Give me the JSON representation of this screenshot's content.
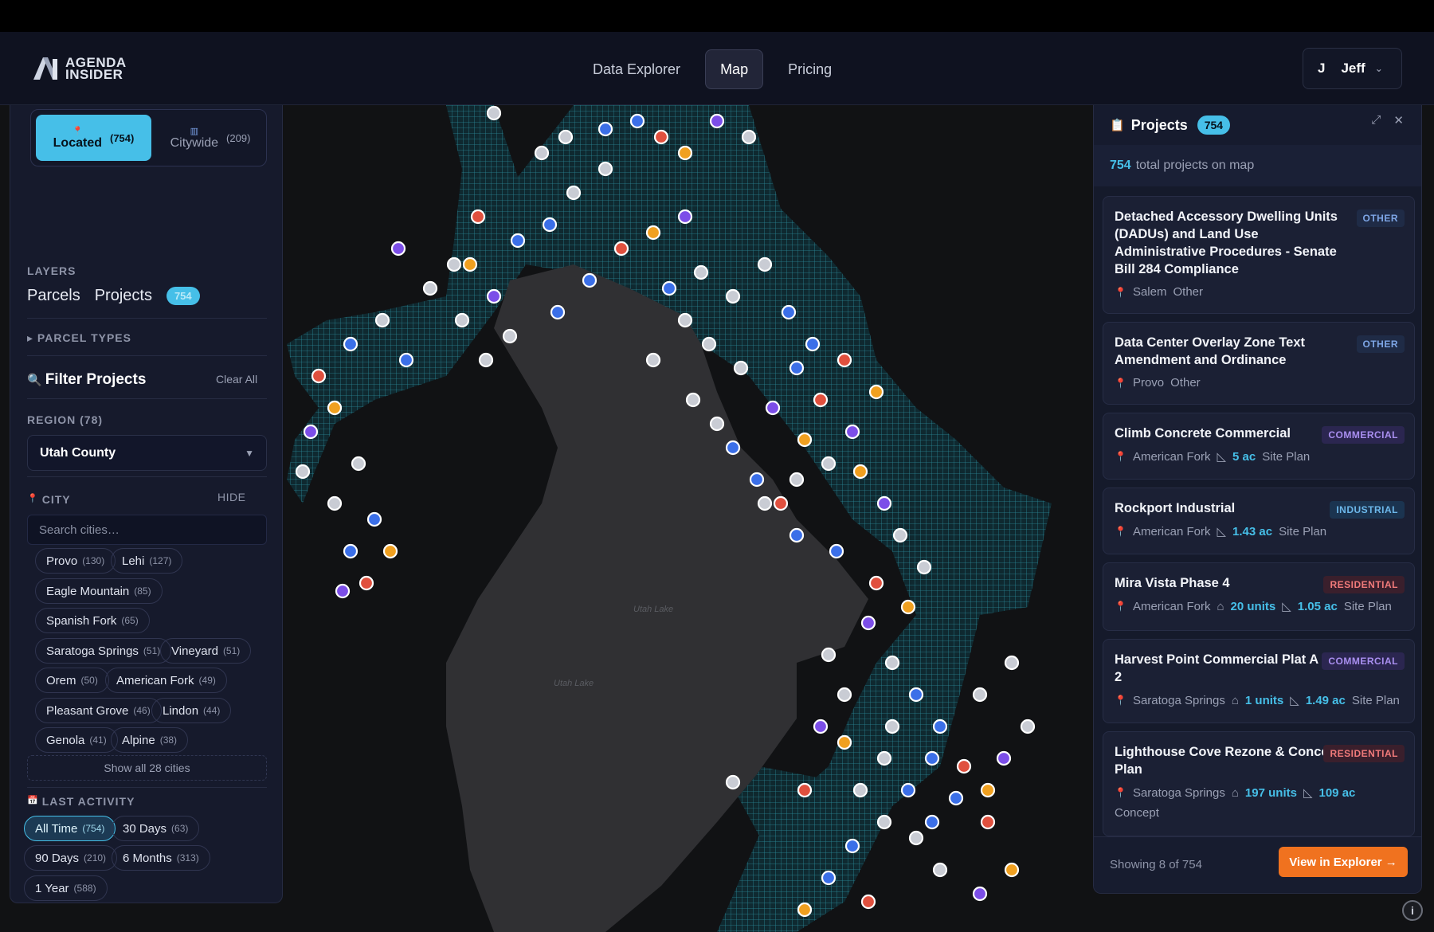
{
  "app": {
    "logo_line1": "AGENDA",
    "logo_line2": "INSIDER"
  },
  "nav": {
    "tabs": [
      "Data Explorer",
      "Map",
      "Pricing"
    ],
    "active": "Map"
  },
  "user": {
    "initial": "J",
    "name": "Jeff"
  },
  "left": {
    "toggle": {
      "located_label": "Located",
      "located_count": "(754)",
      "citywide_label": "Citywide",
      "citywide_count": "(209)"
    },
    "layers_label": "LAYERS",
    "layers": {
      "parcels": "Parcels",
      "projects": "Projects",
      "projects_count": "754"
    },
    "parcel_types": "▸ PARCEL TYPES",
    "filter_title": "Filter Projects",
    "clear_all": "Clear All",
    "region_label": "REGION (78)",
    "region_value": "Utah County",
    "city_label": "CITY",
    "hide": "HIDE",
    "city_search_placeholder": "Search cities…",
    "cities": [
      {
        "name": "Provo",
        "n": "(130)"
      },
      {
        "name": "Lehi",
        "n": "(127)"
      },
      {
        "name": "Eagle Mountain",
        "n": "(85)"
      },
      {
        "name": "Spanish Fork",
        "n": "(65)"
      },
      {
        "name": "Saratoga Springs",
        "n": "(51)"
      },
      {
        "name": "Vineyard",
        "n": "(51)"
      },
      {
        "name": "Orem",
        "n": "(50)"
      },
      {
        "name": "American Fork",
        "n": "(49)"
      },
      {
        "name": "Pleasant Grove",
        "n": "(46)"
      },
      {
        "name": "Lindon",
        "n": "(44)"
      },
      {
        "name": "Genola",
        "n": "(41)"
      },
      {
        "name": "Alpine",
        "n": "(38)"
      }
    ],
    "show_all": "Show all 28 cities",
    "activity_label": "LAST ACTIVITY",
    "activity": [
      {
        "name": "All Time",
        "n": "(754)"
      },
      {
        "name": "30 Days",
        "n": "(63)"
      },
      {
        "name": "90 Days",
        "n": "(210)"
      },
      {
        "name": "6 Months",
        "n": "(313)"
      },
      {
        "name": "1 Year",
        "n": "(588)"
      }
    ]
  },
  "map": {
    "lake_label_1": "Utah Lake",
    "lake_label_2": "Utah Lake"
  },
  "right": {
    "title": "Projects",
    "count": "754",
    "total_num": "754",
    "total_text": "total projects on map",
    "cards": [
      {
        "title": "Detached Accessory Dwelling Units (DADUs) and Land Use Administrative Procedures - Senate Bill 284 Compliance",
        "tag": "OTHER",
        "city": "Salem",
        "extra": "Other"
      },
      {
        "title": "Data Center Overlay Zone Text Amendment and Ordinance",
        "tag": "OTHER",
        "city": "Provo",
        "extra": "Other"
      },
      {
        "title": "Climb Concrete Commercial",
        "tag": "COMMERCIAL",
        "city": "American Fork",
        "acres": "5 ac",
        "extra": "Site Plan"
      },
      {
        "title": "Rockport Industrial",
        "tag": "INDUSTRIAL",
        "city": "American Fork",
        "acres": "1.43 ac",
        "extra": "Site Plan"
      },
      {
        "title": "Mira Vista Phase 4",
        "tag": "RESIDENTIAL",
        "city": "American Fork",
        "units": "20 units",
        "acres": "1.05 ac",
        "extra": "Site Plan"
      },
      {
        "title": "Harvest Point Commercial Plat A Lot 2",
        "tag": "COMMERCIAL",
        "city": "Saratoga Springs",
        "units": "1 units",
        "acres": "1.49 ac",
        "extra": "Site Plan"
      },
      {
        "title": "Lighthouse Cove Rezone & Concept Plan",
        "tag": "RESIDENTIAL",
        "city": "Saratoga Springs",
        "units": "197 units",
        "acres": "109 ac",
        "extra": "Concept"
      }
    ],
    "showing": "Showing 8 of 754",
    "explore_btn": "View in Explorer →"
  },
  "colors": {
    "accent": "#46bfe8",
    "orange": "#f0721f",
    "parcel": "#1f6f7e"
  }
}
